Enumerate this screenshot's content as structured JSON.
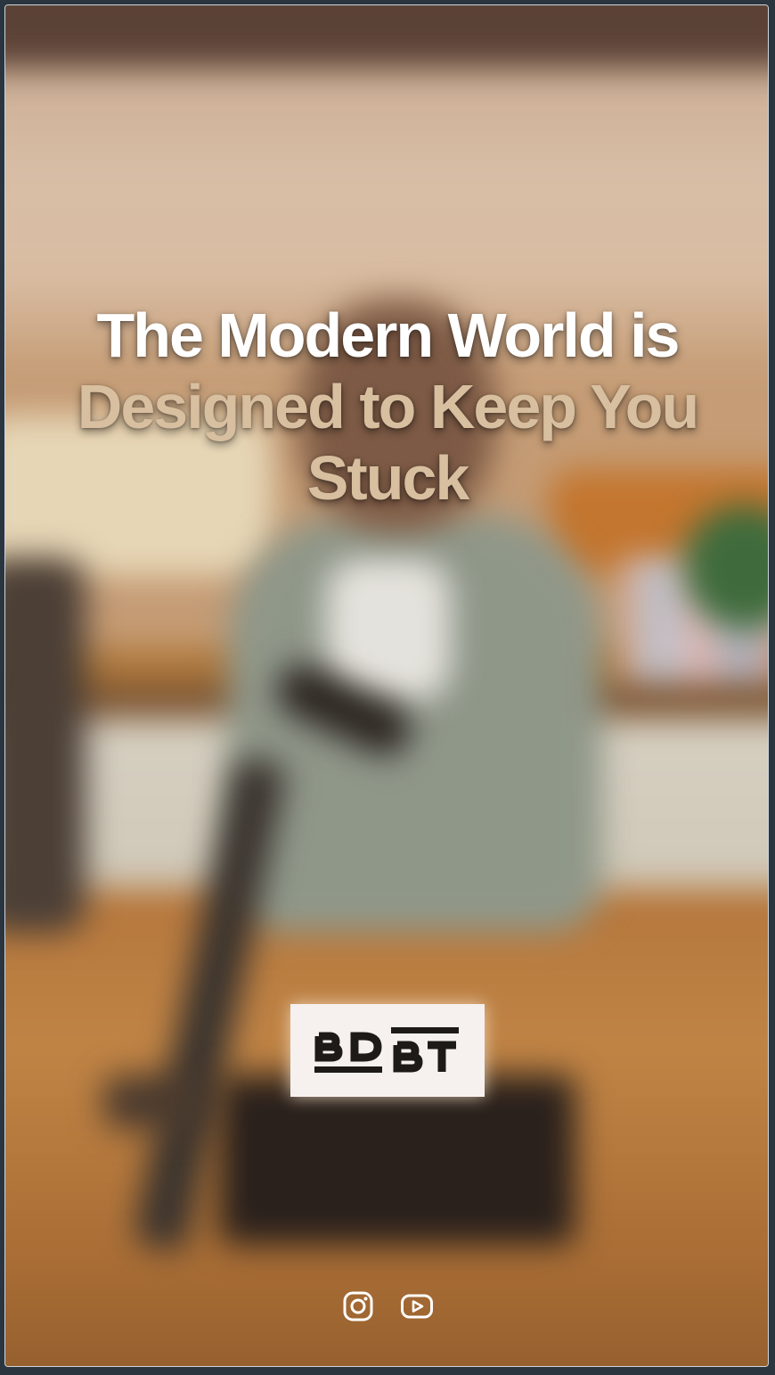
{
  "headline": {
    "line1": "The Modern World is",
    "line2": "Designed to Keep You",
    "line3": "Stuck"
  },
  "logo": {
    "text": "BDBT",
    "icon": "bdbt-logo"
  },
  "social": [
    {
      "icon": "instagram-icon"
    },
    {
      "icon": "youtube-icon"
    }
  ],
  "colors": {
    "headline_primary": "#ffffff",
    "headline_accent": "#d7bf9f",
    "logo_bg": "#f6f1ee",
    "logo_ink": "#1e1a18"
  }
}
